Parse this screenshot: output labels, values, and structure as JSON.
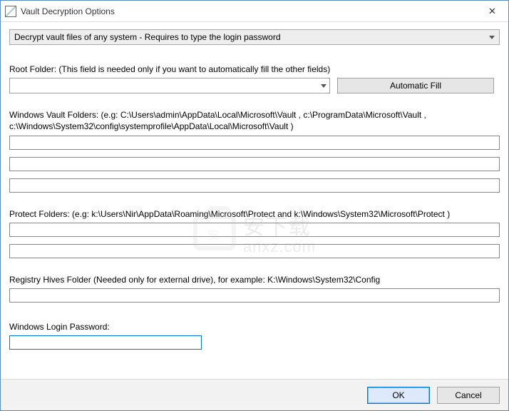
{
  "titlebar": {
    "title": "Vault Decryption Options"
  },
  "mode": {
    "selected": "Decrypt vault files of any system - Requires to type the login password"
  },
  "rootFolder": {
    "label": "Root Folder:  (This field is needed only if you want to automatically fill the other fields)",
    "value": ""
  },
  "buttons": {
    "automaticFill": "Automatic Fill",
    "ok": "OK",
    "cancel": "Cancel"
  },
  "vaultFolders": {
    "label": "Windows Vault Folders:  (e.g: C:\\Users\\admin\\AppData\\Local\\Microsoft\\Vault , c:\\ProgramData\\Microsoft\\Vault , c:\\Windows\\System32\\config\\systemprofile\\AppData\\Local\\Microsoft\\Vault )",
    "values": [
      "",
      "",
      ""
    ]
  },
  "protectFolders": {
    "label": "Protect Folders: (e.g: k:\\Users\\Nir\\AppData\\Roaming\\Microsoft\\Protect and k:\\Windows\\System32\\Microsoft\\Protect )",
    "values": [
      "",
      ""
    ]
  },
  "registryHives": {
    "label": "Registry Hives Folder (Needed only for external drive), for example:  K:\\Windows\\System32\\Config",
    "value": ""
  },
  "loginPassword": {
    "label": "Windows Login Password:",
    "value": ""
  },
  "watermark": {
    "cn": "安下载",
    "en": "anxz.com",
    "safe": "安"
  }
}
